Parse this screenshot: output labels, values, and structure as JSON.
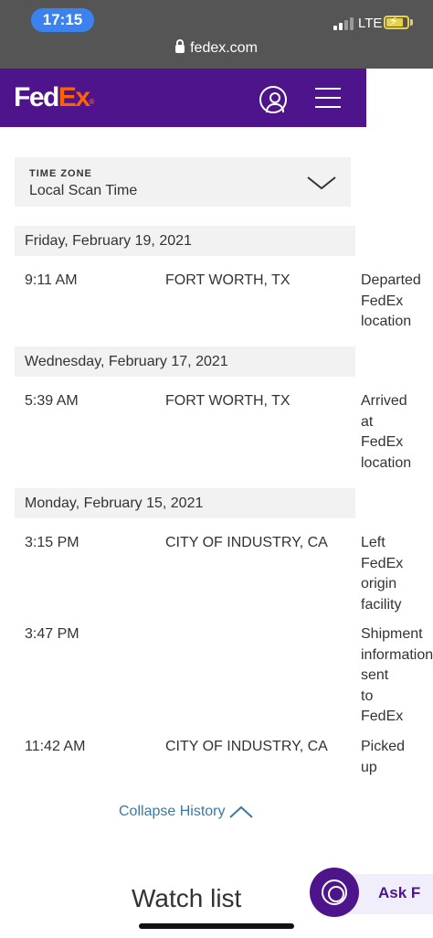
{
  "status_bar": {
    "time": "17:15",
    "network": "LTE",
    "url": "fedex.com"
  },
  "header": {
    "logo_fed": "Fed",
    "logo_ex": "Ex",
    "logo_reg": "®"
  },
  "time_zone": {
    "label": "TIME ZONE",
    "value": "Local Scan Time"
  },
  "days": [
    {
      "date": "Friday, February 19, 2021"
    },
    {
      "date": "Wednesday, February 17, 2021"
    },
    {
      "date": "Monday, February 15, 2021"
    }
  ],
  "events": [
    {
      "time": "9:11 AM",
      "location": "FORT WORTH, TX",
      "status": [
        "Departed",
        "FedEx",
        "location"
      ]
    },
    {
      "time": "5:39 AM",
      "location": "FORT WORTH, TX",
      "status": [
        "Arrived",
        "at",
        "FedEx",
        "location"
      ]
    },
    {
      "time": "3:15 PM",
      "location": "CITY OF INDUSTRY, CA",
      "status": [
        "Left",
        "FedEx",
        "origin",
        "facility"
      ]
    },
    {
      "time": "3:47 PM",
      "location": "",
      "status": [
        "Shipment",
        "information",
        "sent",
        "to",
        "FedEx"
      ]
    },
    {
      "time": "11:42 AM",
      "location": "CITY OF INDUSTRY, CA",
      "status": [
        "Picked",
        "up"
      ]
    }
  ],
  "collapse_label": "Collapse History",
  "watch_list_title": "Watch list",
  "ask_label": "Ask F",
  "colors": {
    "brand_purple": "#4d148c",
    "brand_orange": "#ff6200",
    "link_blue": "#3a78a8"
  }
}
